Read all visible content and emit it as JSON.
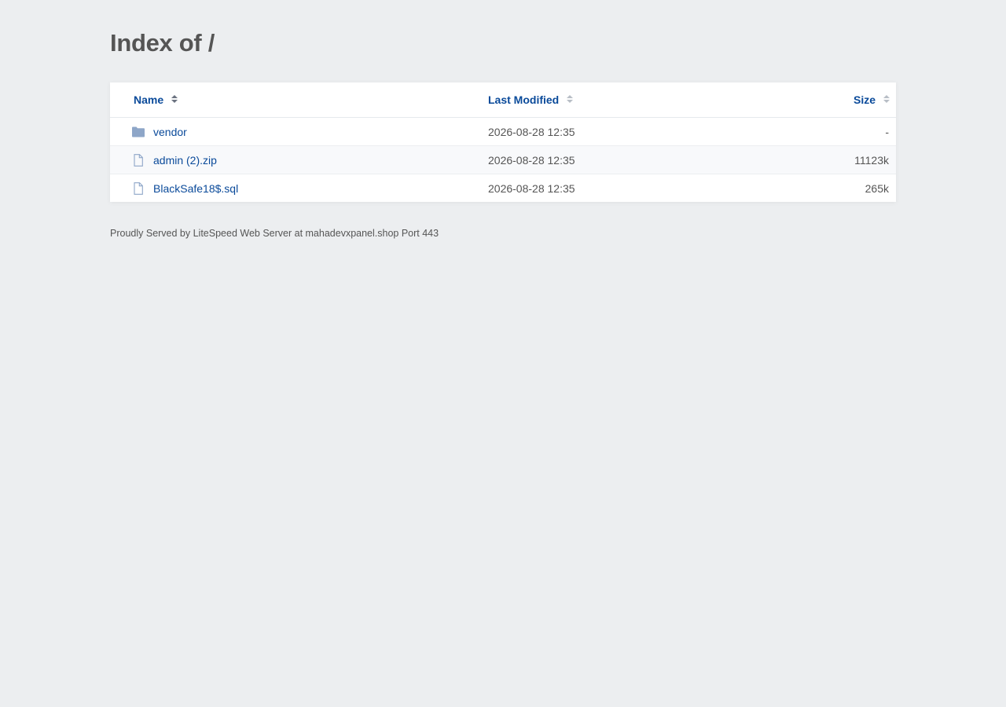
{
  "title": "Index of /",
  "columns": {
    "name": "Name",
    "modified": "Last Modified",
    "size": "Size"
  },
  "rows": [
    {
      "icon": "folder-icon",
      "name": "vendor",
      "modified": "2026-08-28 12:35",
      "size": "-"
    },
    {
      "icon": "file-icon",
      "name": "admin (2).zip",
      "modified": "2026-08-28 12:35",
      "size": "11123k"
    },
    {
      "icon": "file-icon",
      "name": "BlackSafe18$.sql",
      "modified": "2026-08-28 12:35",
      "size": "265k"
    }
  ],
  "footer": "Proudly Served by LiteSpeed Web Server at mahadevxpanel.shop Port 443",
  "colors": {
    "link": "#0a4a9a",
    "text": "#555555",
    "background": "#eceef0",
    "icon": "#8ea6c8"
  }
}
